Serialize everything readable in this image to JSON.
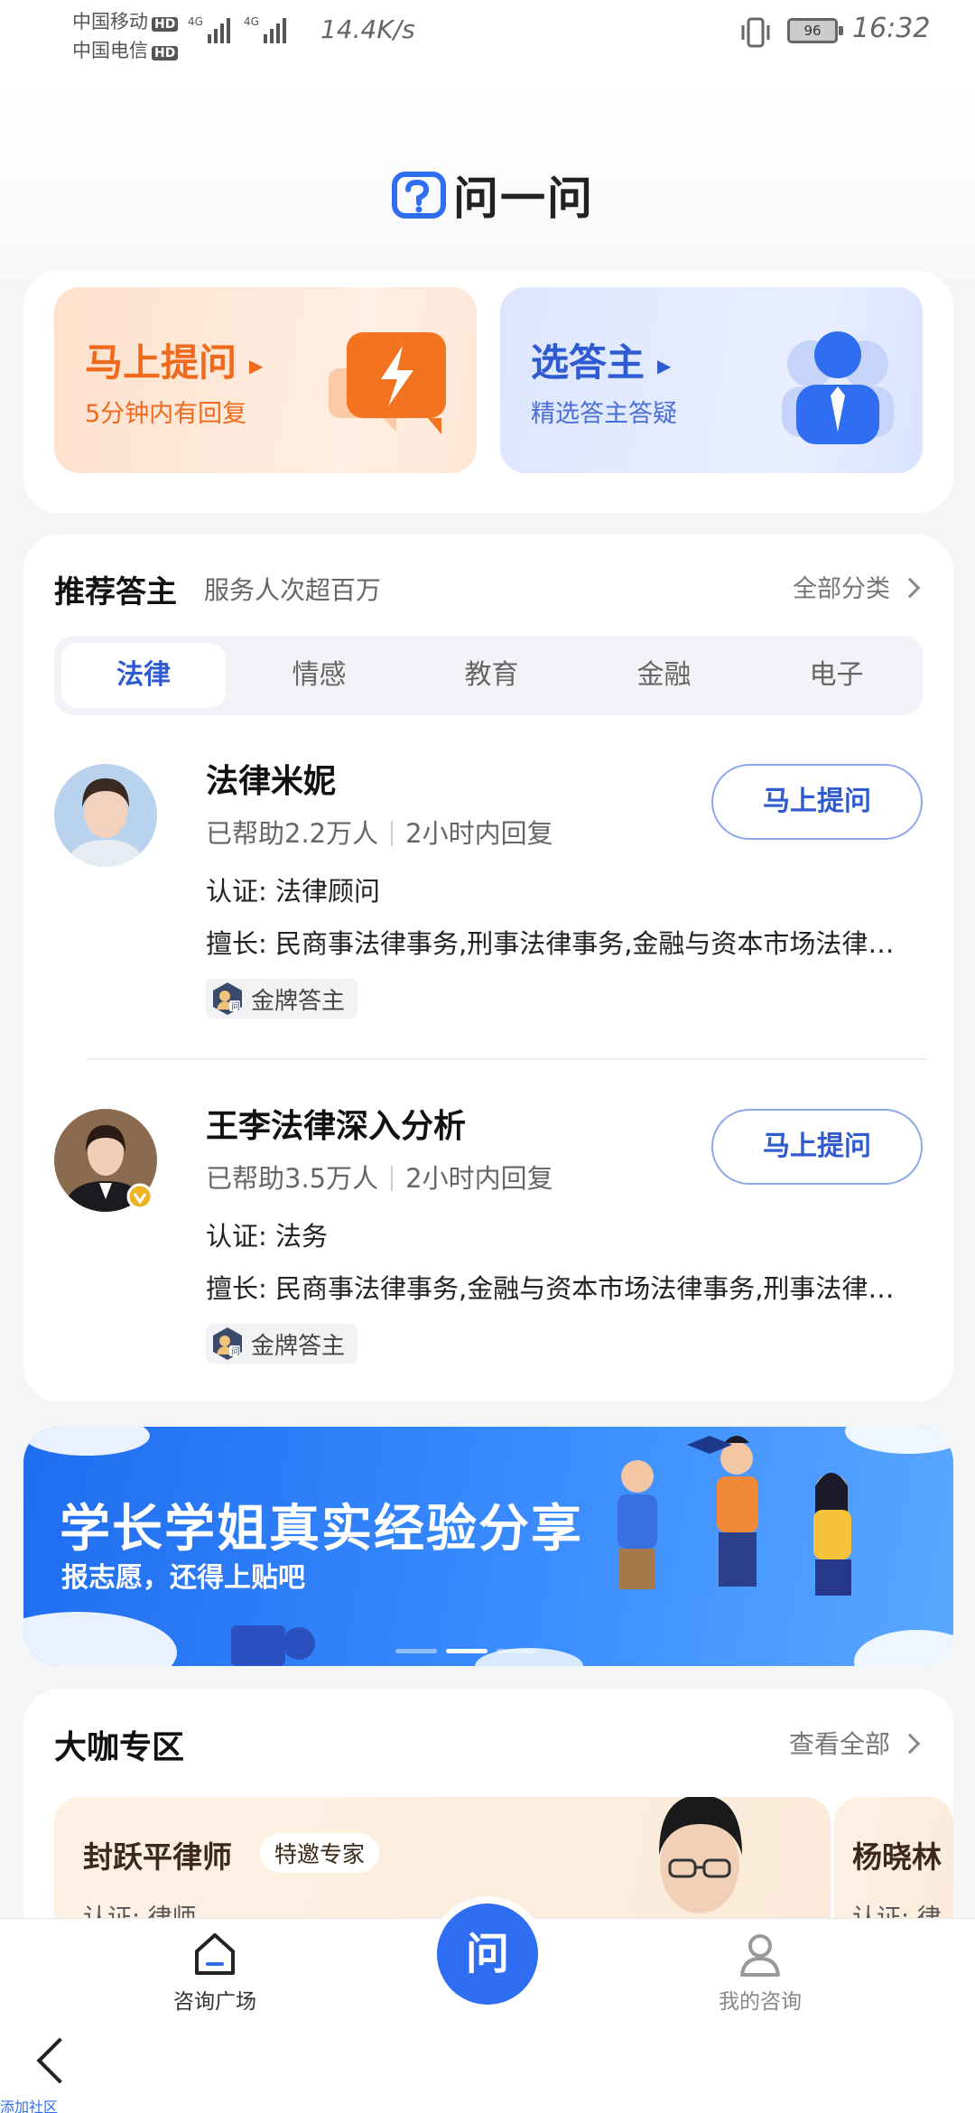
{
  "status_bar": {
    "carrier1": "中国移动",
    "carrier2": "中国电信",
    "hd_label": "HD",
    "net1": "4G",
    "net2": "4G",
    "speed": "14.4K/s",
    "battery": "96",
    "time": "16:32"
  },
  "header": {
    "logo_text": "问一问"
  },
  "quick_actions": {
    "ask": {
      "title": "马上提问",
      "subtitle": "5分钟内有回复"
    },
    "pick": {
      "title": "选答主",
      "subtitle": "精选答主答疑"
    }
  },
  "recommended": {
    "title": "推荐答主",
    "subtitle": "服务人次超百万",
    "all_label": "全部分类",
    "tabs": [
      {
        "label": "法律",
        "active": true
      },
      {
        "label": "情感"
      },
      {
        "label": "教育"
      },
      {
        "label": "金融"
      },
      {
        "label": "电子"
      }
    ],
    "experts": [
      {
        "name": "法律米妮",
        "helped": "已帮助2.2万人",
        "reply": "2小时内回复",
        "cert": "认证:  法律顾问",
        "specialty": "擅长:  民商事法律事务,刑事法律事务,金融与资本市场法律事务",
        "badge": "金牌答主",
        "button": "马上提问"
      },
      {
        "name": "王李法律深入分析",
        "helped": "已帮助3.5万人",
        "reply": "2小时内回复",
        "cert": "认证:  法务",
        "specialty": "擅长:  民商事法律事务,金融与资本市场法律事务,刑事法律事务",
        "badge": "金牌答主",
        "button": "马上提问"
      }
    ]
  },
  "banner": {
    "title": "学长学姐真实经验分享",
    "subtitle": "报志愿，还得上贴吧"
  },
  "big_shots": {
    "title": "大咖专区",
    "all_label": "查看全部",
    "cards": [
      {
        "name": "封跃平律师",
        "tag": "特邀专家",
        "cert": "认证:  律师"
      },
      {
        "name": "杨晓林",
        "cert": "认证:  律"
      }
    ]
  },
  "tabbar": {
    "left_label": "咨询广场",
    "center_label": "问",
    "right_label": "我的咨询"
  },
  "footnote": "添加社区",
  "colors": {
    "brand_blue": "#2f5bd2",
    "accent_orange": "#f06a1d",
    "fab_blue": "#2f6df2"
  }
}
